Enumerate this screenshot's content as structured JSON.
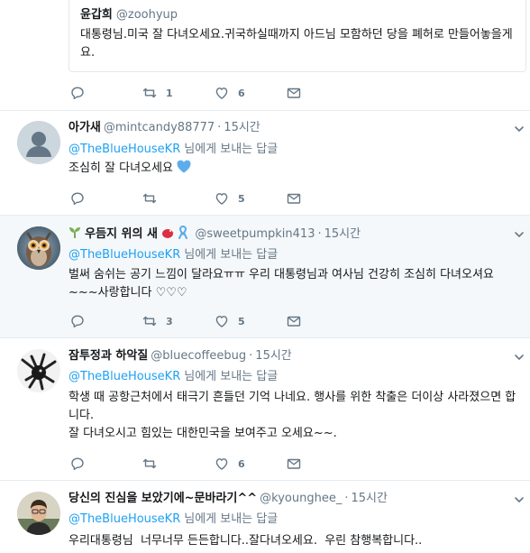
{
  "quoted": {
    "name": "윤갑희",
    "handle": "@zoohyup",
    "text": "대통령님.미국 잘 다녀오세요.귀국하실때까지 아드님 모함하던 당을 폐허로 만들어놓을게요.",
    "actions": {
      "retweets": "1",
      "likes": "6"
    }
  },
  "tweets": [
    {
      "name": "아가새",
      "handle": "@mintcandy88777",
      "time": "15시간",
      "reply_to": "@TheBlueHouseKR",
      "reply_suffix": "님에게 보내는 답글",
      "text": "조심히 잘 다녀오세요",
      "heart_emoji": "blue-heart",
      "retweets": "",
      "likes": "5",
      "avatar": "default-profile"
    },
    {
      "name": "우듬지 위의 새",
      "name_prefix_emoji": "seedling",
      "name_suffix_emojis": [
        "bird",
        "ribbon"
      ],
      "handle": "@sweetpumpkin413",
      "time": "15시간",
      "reply_to": "@TheBlueHouseKR",
      "reply_suffix": "님에게 보내는 답글",
      "text": "벌써 숨쉬는 공기 느낌이 달라요ㅠㅠ 우리 대통령님과 여사님 건강히 조심히 다녀오셔요 ~~~사랑합니다 ♡♡♡",
      "retweets": "3",
      "likes": "5",
      "avatar": "owl",
      "highlight": true
    },
    {
      "name": "잠투정과 하악질",
      "handle": "@bluecoffeebug",
      "time": "15시간",
      "reply_to": "@TheBlueHouseKR",
      "reply_suffix": "님에게 보내는 답글",
      "text_lines": [
        "학생 때 공항근처에서 태극기 흔들던 기억 나네요. 행사를 위한 착출은 더이상 사라졌으면 합니다.",
        "잘 다녀오시고 힘있는 대한민국을 보여주고 오세요~~."
      ],
      "retweets": "",
      "likes": "6",
      "avatar": "dark-feathers"
    },
    {
      "name": "당신의 진심을 보았기에~문바라기^^",
      "handle": "@kyounghee_",
      "time": "15시간",
      "reply_to": "@TheBlueHouseKR",
      "reply_suffix": "님에게 보내는 답글",
      "text": "우리대통령님  너무너무 든든합니다..잘다녀오세요.  우린 참행복합니다..",
      "avatar": "man-photo"
    }
  ],
  "colors": {
    "link": "#1da1f2",
    "muted": "#657786",
    "text": "#14171a",
    "border": "#e6ecf0",
    "highlight_bg": "#f5f8fa"
  }
}
